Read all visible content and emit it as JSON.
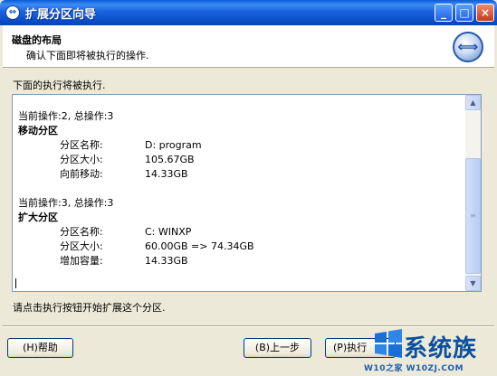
{
  "window": {
    "title": "扩展分区向导",
    "title_icon": "wizard-arrow-icon",
    "buttons": {
      "minimize": "_",
      "maximize": "□",
      "close": "×"
    }
  },
  "header": {
    "title": "磁盘的布局",
    "subtitle": "确认下面即将被执行的操作.",
    "logo_icon": "resize-arrows-icon",
    "logo_glyph": "⟺"
  },
  "intro": "下面的执行将被执行.",
  "log": {
    "operations": [
      {
        "head": "当前操作:2, 总操作:3",
        "title": "移动分区",
        "rows": [
          {
            "key": "分区名称:",
            "value": "D: program"
          },
          {
            "key": "分区大小:",
            "value": "105.67GB"
          },
          {
            "key": "向前移动:",
            "value": "14.33GB"
          }
        ]
      },
      {
        "head": "当前操作:3, 总操作:3",
        "title": "扩大分区",
        "rows": [
          {
            "key": "分区名称:",
            "value": "C: WINXP"
          },
          {
            "key": "分区大小:",
            "value": "60.00GB => 74.34GB"
          },
          {
            "key": "增加容量:",
            "value": "14.33GB"
          }
        ]
      }
    ]
  },
  "note": "请点击执行按钮开始扩展这个分区.",
  "buttons": {
    "help": "(H)帮助",
    "back": "(B)上一步",
    "exec": "(P)执行"
  },
  "watermark": {
    "text": "系统族",
    "url": "W10之家 W10ZJ.COM"
  },
  "colors": {
    "titlebar": "#0b4fc9",
    "dialog_bg": "#ece9d8",
    "watermark": "#0b4f9e"
  }
}
